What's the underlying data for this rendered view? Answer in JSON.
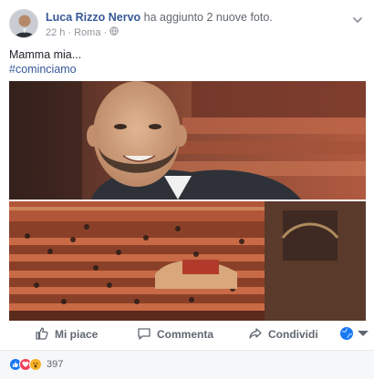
{
  "post": {
    "author": "Luca Rizzo Nervo",
    "action": "ha aggiunto 2 nuove foto.",
    "time": "22 h",
    "location": "Roma",
    "text": "Mamma mia...",
    "hashtag": "#cominciamo"
  },
  "actions": {
    "like": "Mi piace",
    "comment": "Commenta",
    "share": "Condividi"
  },
  "reactions": {
    "types": [
      "like",
      "love",
      "wow"
    ],
    "count": "397"
  },
  "icons": {
    "privacy": "globe-icon",
    "menu": "chevron-down-icon",
    "like": "thumbs-up-icon",
    "comment": "speech-bubble-icon",
    "share": "share-arrow-icon",
    "audience": "globe-icon"
  },
  "colors": {
    "link": "#365899",
    "secondary": "#90949c",
    "like_blue": "#1877f2",
    "love_red": "#f33e58",
    "wow_yellow": "#f7b125"
  }
}
